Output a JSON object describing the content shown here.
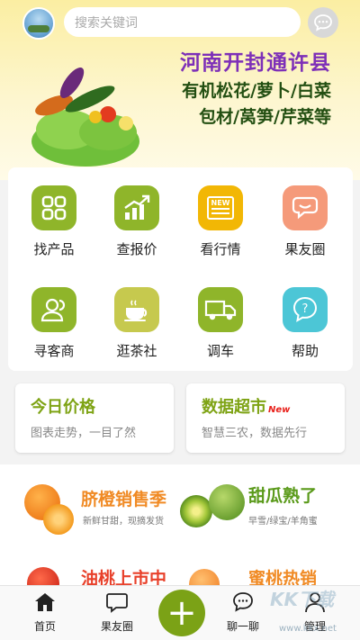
{
  "search": {
    "placeholder": "搜索关键词"
  },
  "banner": {
    "line1": "河南开封通许县",
    "line2": "有机松花/萝卜/白菜",
    "line3": "包材/莴笋/芹菜等"
  },
  "grid": [
    {
      "label": "找产品",
      "icon": "grid-icon",
      "color": "#8fb52a"
    },
    {
      "label": "查报价",
      "icon": "chart-icon",
      "color": "#8fb52a"
    },
    {
      "label": "看行情",
      "icon": "news-icon",
      "color": "#f2b705"
    },
    {
      "label": "果友圈",
      "icon": "chat-bubbles-icon",
      "color": "#f59a7a"
    },
    {
      "label": "寻客商",
      "icon": "person-icon",
      "color": "#8fb52a"
    },
    {
      "label": "逛茶社",
      "icon": "tea-cup-icon",
      "color": "#c6c94e"
    },
    {
      "label": "调车",
      "icon": "truck-icon",
      "color": "#8fb52a"
    },
    {
      "label": "帮助",
      "icon": "help-icon",
      "color": "#4cc6d6"
    }
  ],
  "features": {
    "today_price": {
      "title": "今日价格",
      "subtitle": "图表走势，一目了然"
    },
    "data_market": {
      "title": "数据超市",
      "badge": "New",
      "subtitle": "智慧三农，数据先行"
    }
  },
  "products": [
    {
      "title": "脐橙销售季",
      "subtitle": "新鲜甘甜，现摘发货",
      "color": "#f08a24"
    },
    {
      "title": "甜瓜熟了",
      "subtitle": "早雪/绿宝/羊角蜜",
      "color": "#5a9a1a"
    },
    {
      "title": "油桃上市中",
      "color": "#e8402a"
    },
    {
      "title": "蜜桃热销",
      "color": "#f08a24"
    }
  ],
  "bottom_nav": [
    {
      "label": "首页",
      "icon": "home-icon"
    },
    {
      "label": "果友圈",
      "icon": "chat-icon"
    },
    {
      "label": "聊一聊",
      "icon": "message-icon"
    },
    {
      "label": "管理",
      "icon": "user-icon"
    }
  ],
  "fab": {
    "label": "+"
  },
  "watermark": {
    "text": "KK下载",
    "url": "www.kkx.net"
  }
}
